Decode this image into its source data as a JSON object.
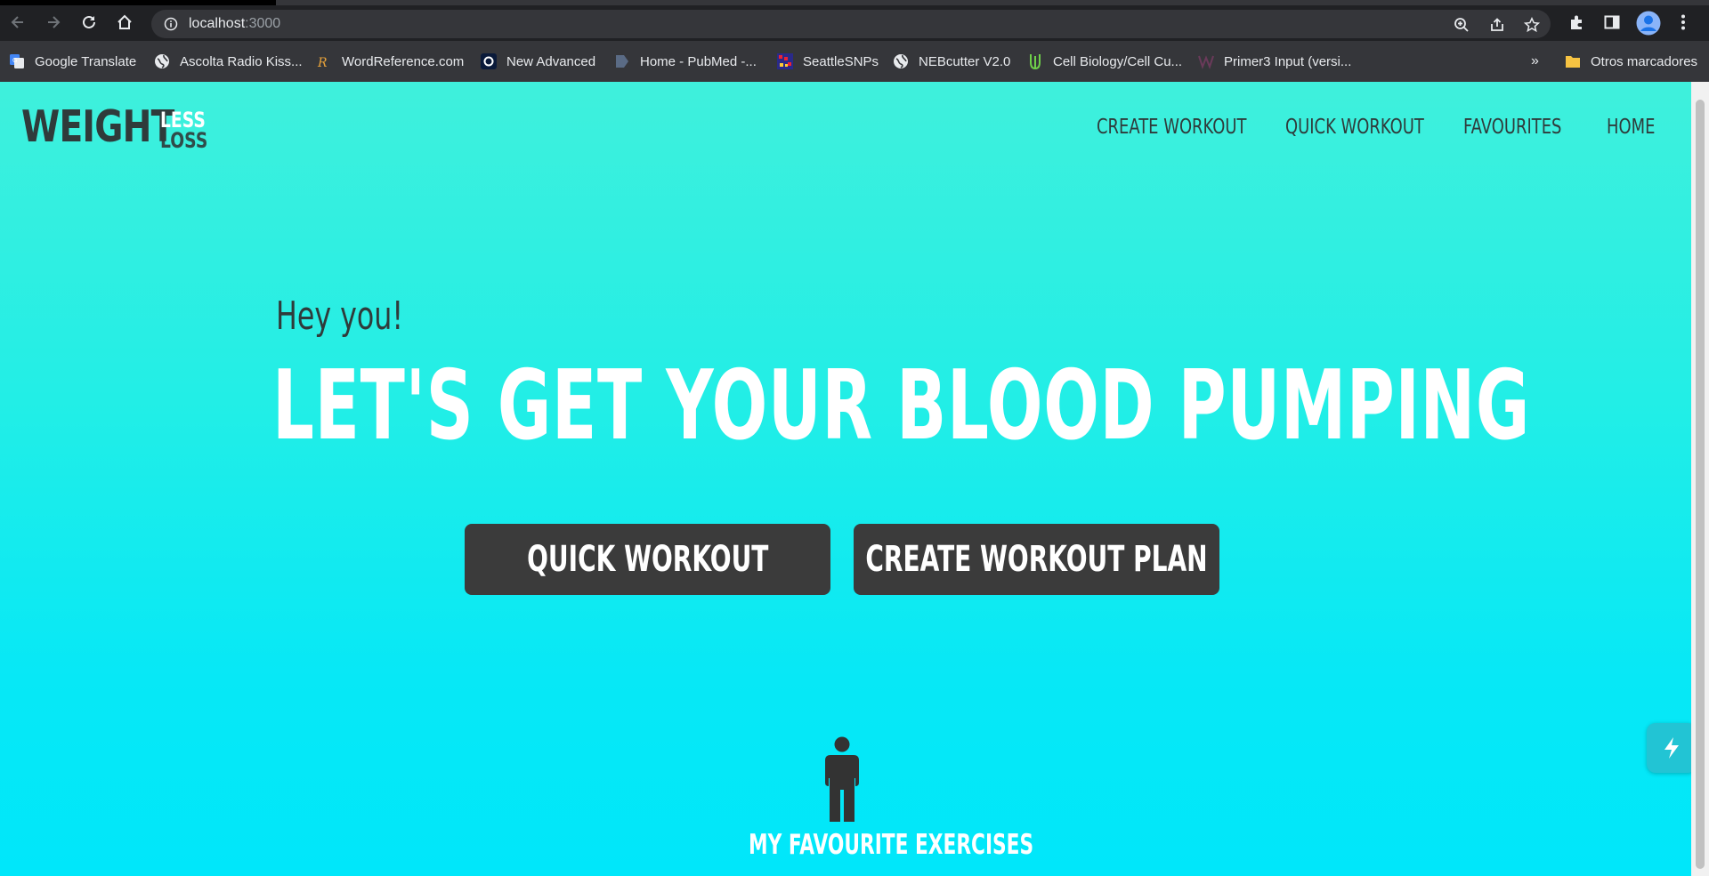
{
  "browser": {
    "url_host": "localhost",
    "url_port": ":3000",
    "bookmarks": [
      {
        "label": "Google Translate",
        "icon": "google-translate-icon"
      },
      {
        "label": "Ascolta Radio Kiss...",
        "icon": "globe-icon"
      },
      {
        "label": "WordReference.com",
        "icon": "wordreference-icon"
      },
      {
        "label": "New Advanced",
        "icon": "o-logo-icon"
      },
      {
        "label": "Home - PubMed -...",
        "icon": "pubmed-icon"
      },
      {
        "label": "SeattleSNPs",
        "icon": "seattlesnps-icon"
      },
      {
        "label": "NEBcutter V2.0",
        "icon": "globe-icon"
      },
      {
        "label": "Cell Biology/Cell Cu...",
        "icon": "cell-biology-icon"
      },
      {
        "label": "Primer3 Input (versi...",
        "icon": "primer3-icon"
      }
    ],
    "overflow_label": "»",
    "other_bookmarks_label": "Otros marcadores"
  },
  "header": {
    "logo_main": "WEIGHT",
    "logo_top": "LESS",
    "logo_bottom": "LOSS",
    "nav": [
      "CREATE WORKOUT",
      "QUICK WORKOUT",
      "FAVOURITES",
      "HOME"
    ]
  },
  "hero": {
    "greeting": "Hey you!",
    "headline": "LET'S GET YOUR BLOOD PUMPING",
    "buttons": [
      "QUICK WORKOUT",
      "CREATE WORKOUT PLAN"
    ]
  },
  "favourites": {
    "label": "MY FAVOURITE EXERCISES",
    "icon": "person-icon"
  },
  "colors": {
    "accent_top": "#3ff0dc",
    "accent_bottom": "#00e7fa",
    "button_bg": "#3b3b3b",
    "text_dark": "#2f3b3b"
  }
}
